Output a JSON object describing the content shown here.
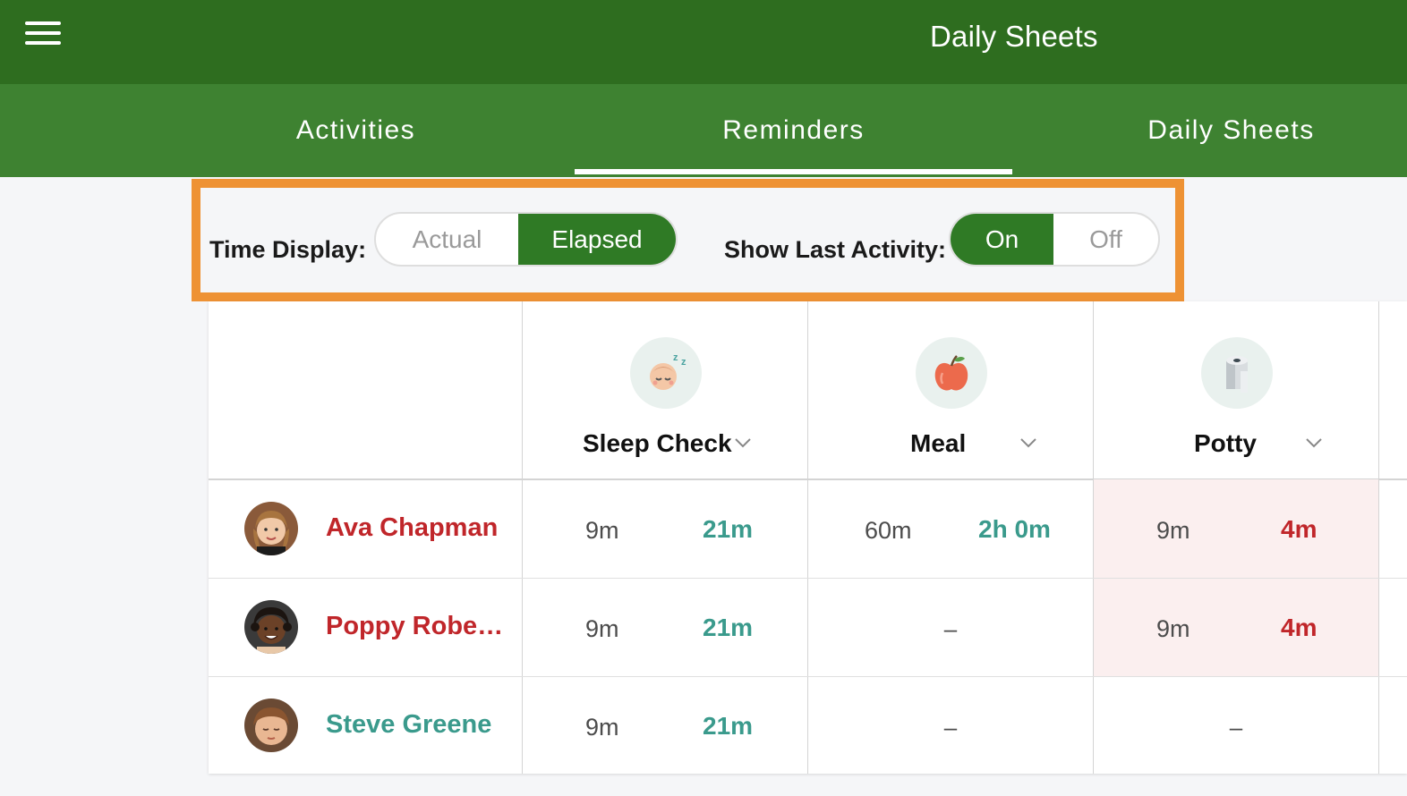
{
  "header": {
    "title": "Daily Sheets",
    "menu_icon": "hamburger-menu-icon"
  },
  "tabs": [
    {
      "label": "Activities",
      "active": false
    },
    {
      "label": "Reminders",
      "active": true
    },
    {
      "label": "Daily Sheets",
      "active": false
    }
  ],
  "controls": {
    "time_display": {
      "label": "Time Display:",
      "options": [
        "Actual",
        "Elapsed"
      ],
      "selected": "Elapsed"
    },
    "show_last_activity": {
      "label": "Show Last Activity:",
      "options": [
        "On",
        "Off"
      ],
      "selected": "On"
    }
  },
  "columns": [
    {
      "title": "Sleep Check",
      "icon": "sleeping-baby-icon"
    },
    {
      "title": "Meal",
      "icon": "apple-icon"
    },
    {
      "title": "Potty",
      "icon": "toilet-paper-icon"
    }
  ],
  "rows": [
    {
      "name": "Ava Chapman",
      "name_status": "overdue",
      "cells": [
        {
          "last": "9m",
          "elapsed": "21m",
          "overdue": false
        },
        {
          "last": "60m",
          "elapsed": "2h 0m",
          "overdue": false
        },
        {
          "last": "9m",
          "elapsed": "4m",
          "overdue": true
        }
      ]
    },
    {
      "name": "Poppy Rober…",
      "name_status": "overdue",
      "cells": [
        {
          "last": "9m",
          "elapsed": "21m",
          "overdue": false
        },
        {
          "empty": "–"
        },
        {
          "last": "9m",
          "elapsed": "4m",
          "overdue": true
        }
      ]
    },
    {
      "name": "Steve Greene",
      "name_status": "ok",
      "cells": [
        {
          "last": "9m",
          "elapsed": "21m",
          "overdue": false
        },
        {
          "empty": "–"
        },
        {
          "empty": "–"
        }
      ]
    }
  ],
  "colors": {
    "header": "#2e6d1f",
    "tabbar": "#3e8231",
    "highlight": "#ee9234",
    "teal": "#3a9a8c",
    "red": "#c0262a",
    "alert_bg": "#fbefef"
  }
}
